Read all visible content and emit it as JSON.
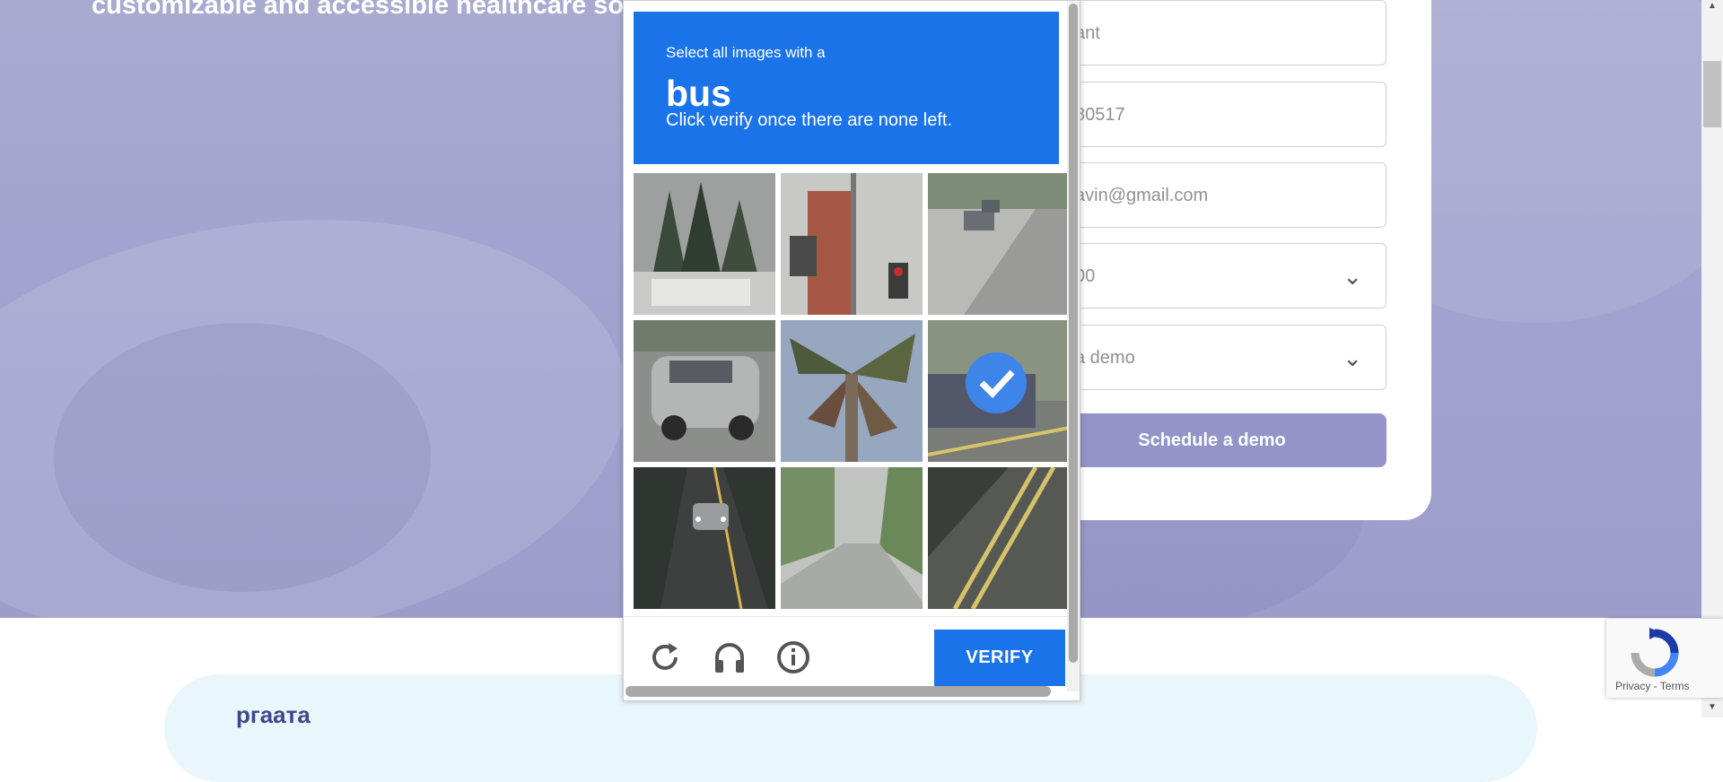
{
  "page": {
    "hero_text": "customizable and accessible healthcare solut",
    "form": {
      "fields": [
        {
          "name": "company",
          "value": "ant"
        },
        {
          "name": "phone",
          "value": "80517"
        },
        {
          "name": "email",
          "value": "avin@gmail.com"
        },
        {
          "name": "size",
          "value": "00",
          "dropdown": true
        },
        {
          "name": "interest",
          "value": "a demo",
          "dropdown": true
        }
      ],
      "submit_label": "Schedule a demo"
    },
    "lower_text": "ргаата"
  },
  "captcha": {
    "instruction_prefix": "Select all images with a",
    "target": "bus",
    "instruction_suffix": "Click verify once there are none left.",
    "tiles": [
      {
        "content": "trees and vehicle",
        "selected": false
      },
      {
        "content": "building with traffic light",
        "selected": false
      },
      {
        "content": "street with cars",
        "selected": false
      },
      {
        "content": "silver suv",
        "selected": false
      },
      {
        "content": "palm tree",
        "selected": false
      },
      {
        "content": "truck on road",
        "selected": true
      },
      {
        "content": "car on road",
        "selected": false
      },
      {
        "content": "road and trees",
        "selected": false
      },
      {
        "content": "road markings",
        "selected": false
      }
    ],
    "verify_label": "VERIFY",
    "icons": [
      "reload-icon",
      "audio-icon",
      "info-icon"
    ],
    "accent_color": "#1a73e8"
  },
  "recaptcha_badge": {
    "links": "Privacy - Terms"
  }
}
